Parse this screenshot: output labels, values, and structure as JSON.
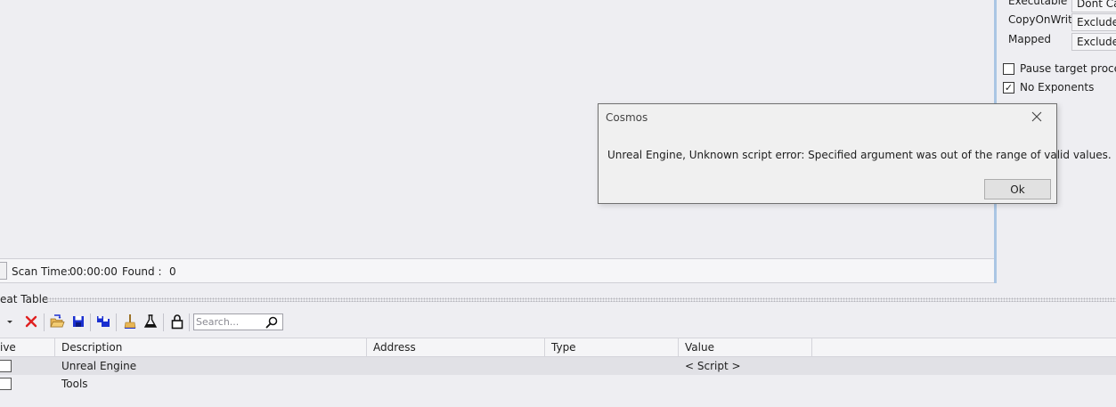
{
  "scan_options": {
    "rows": [
      {
        "label": "Executable",
        "value": "Dont Care"
      },
      {
        "label": "CopyOnWrite",
        "value": "Exclude"
      },
      {
        "label": "Mapped",
        "value": "Exclude"
      }
    ],
    "checks": [
      {
        "label": "Pause target process",
        "checked": false
      },
      {
        "label": "No Exponents",
        "checked": true
      }
    ]
  },
  "status_bar": {
    "scan_time_label": "Scan Time:",
    "scan_time_value": "00:00:00",
    "found_label": "Found :",
    "found_value": "0"
  },
  "cheat_table": {
    "title": "eat Table",
    "search": {
      "placeholder": "Search..."
    },
    "columns": [
      "ive",
      "Description",
      "Address",
      "Type",
      "Value"
    ],
    "rows": [
      {
        "description": "Unreal Engine",
        "address": "",
        "type": "",
        "value": "< Script >",
        "selected": true
      },
      {
        "description": "Tools",
        "address": "",
        "type": "",
        "value": "",
        "selected": false
      }
    ]
  },
  "dialog": {
    "title": "Cosmos",
    "message": "Unreal Engine, Unknown script error: Specified argument was out of the range of valid values.",
    "ok_label": "Ok"
  },
  "icons": {
    "dropdown": "chevron-down-icon",
    "delete": "delete-icon",
    "open": "open-folder-icon",
    "save": "save-icon",
    "save_all": "save-multiple-icon",
    "clear": "broom-icon",
    "test": "flask-icon",
    "lock": "padlock-icon",
    "search": "search-icon",
    "close": "close-icon"
  },
  "colors": {
    "accent": "#aac6e4",
    "delete_red": "#e02020",
    "save_blue": "#1a2fd0"
  }
}
